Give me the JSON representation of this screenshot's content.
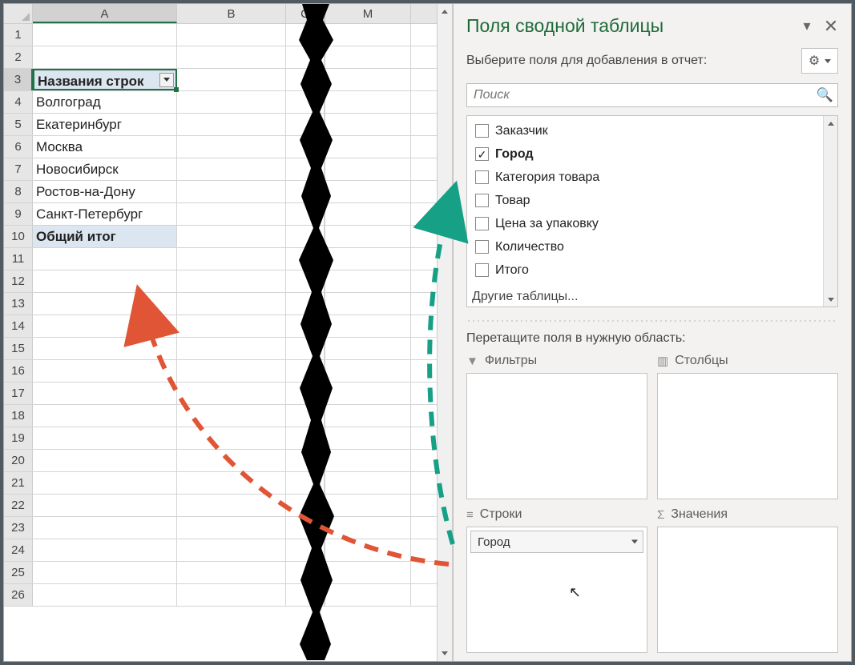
{
  "sheet": {
    "columns": [
      "A",
      "B",
      "C",
      "M"
    ],
    "rows": [
      {
        "n": 1,
        "A": "",
        "B": "",
        "C": "",
        "M": ""
      },
      {
        "n": 2,
        "A": "",
        "B": "",
        "C": "",
        "M": ""
      },
      {
        "n": 3,
        "A": "Названия строк",
        "B": "",
        "C": "",
        "M": "",
        "is_header": true
      },
      {
        "n": 4,
        "A": "Волгоград"
      },
      {
        "n": 5,
        "A": "Екатеринбург"
      },
      {
        "n": 6,
        "A": "Москва"
      },
      {
        "n": 7,
        "A": "Новосибирск"
      },
      {
        "n": 8,
        "A": "Ростов-на-Дону"
      },
      {
        "n": 9,
        "A": "Санкт-Петербург"
      },
      {
        "n": 10,
        "A": "Общий итог",
        "grand": true
      },
      {
        "n": 11
      },
      {
        "n": 12
      },
      {
        "n": 13
      },
      {
        "n": 14
      },
      {
        "n": 15
      },
      {
        "n": 16
      },
      {
        "n": 17
      },
      {
        "n": 18
      },
      {
        "n": 19
      },
      {
        "n": 20
      },
      {
        "n": 21
      },
      {
        "n": 22
      },
      {
        "n": 23
      },
      {
        "n": 24
      },
      {
        "n": 25
      },
      {
        "n": 26
      }
    ]
  },
  "pane": {
    "title": "Поля сводной таблицы",
    "choose_label": "Выберите поля для добавления в отчет:",
    "search_placeholder": "Поиск",
    "fields": [
      {
        "label": "Заказчик",
        "checked": false
      },
      {
        "label": "Город",
        "checked": true
      },
      {
        "label": "Категория товара",
        "checked": false
      },
      {
        "label": "Товар",
        "checked": false
      },
      {
        "label": "Цена за упаковку",
        "checked": false
      },
      {
        "label": "Количество",
        "checked": false
      },
      {
        "label": "Итого",
        "checked": false
      }
    ],
    "other_tables": "Другие таблицы...",
    "drag_label": "Перетащите поля в нужную область:",
    "areas": {
      "filters": {
        "label": "Фильтры",
        "items": []
      },
      "columns": {
        "label": "Столбцы",
        "items": []
      },
      "rows": {
        "label": "Строки",
        "items": [
          "Город"
        ]
      },
      "values": {
        "label": "Значения",
        "items": []
      }
    }
  }
}
